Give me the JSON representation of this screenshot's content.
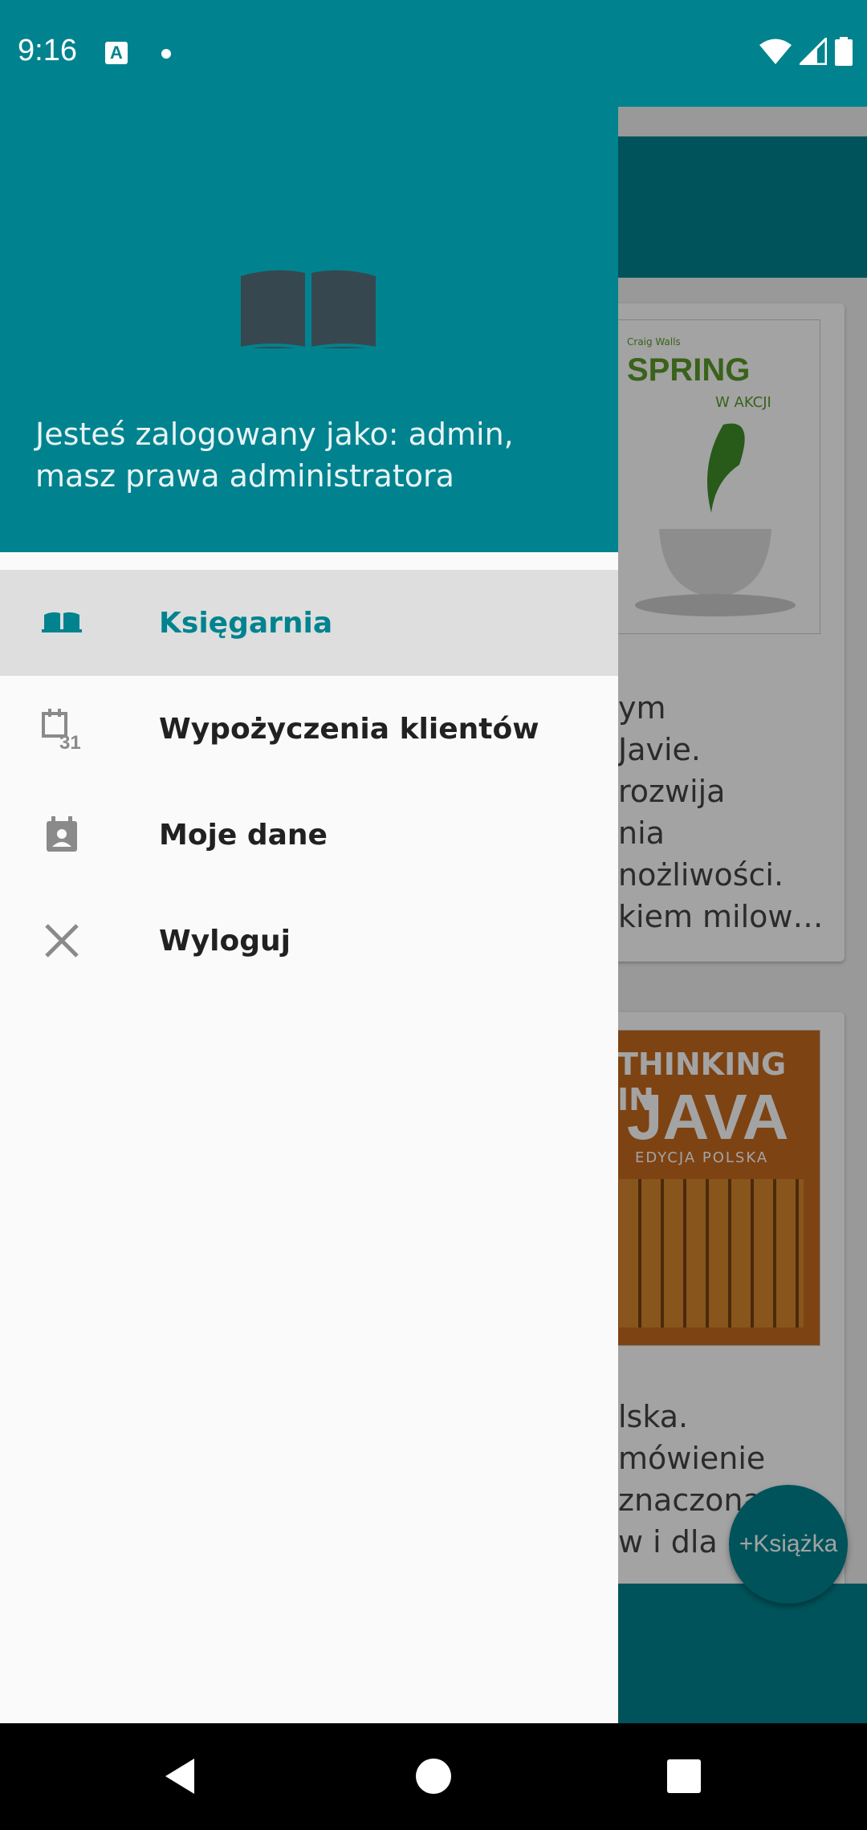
{
  "status_bar": {
    "time": "9:16",
    "notification_letter": "A",
    "icons": [
      "a-notification-icon",
      "dot-icon",
      "wifi-icon",
      "signal-icon",
      "battery-icon"
    ]
  },
  "drawer": {
    "header_text": "Jesteś zalogowany jako: admin, masz prawa administratora",
    "header_icon": "open-book-icon",
    "items": [
      {
        "label": "Księgarnia",
        "icon": "book-icon",
        "active": true
      },
      {
        "label": "Wypożyczenia klientów",
        "icon": "calendar-icon",
        "active": false
      },
      {
        "label": "Moje dane",
        "icon": "contact-icon",
        "active": false
      },
      {
        "label": "Wyloguj",
        "icon": "close-icon",
        "active": false
      }
    ]
  },
  "background": {
    "card1": {
      "cover_author": "Craig Walls",
      "cover_title": "SPRING",
      "cover_subtitle": "W AKCJI",
      "text_lines": [
        "ym",
        "Javie.",
        "rozwija",
        "nia",
        "nożliwości.",
        "kiem milow…"
      ]
    },
    "card2": {
      "cover_title_1": "THINKING IN",
      "cover_title_2": "JAVA",
      "cover_subtitle": "EDYCJA POLSKA",
      "text_lines": [
        "lska.",
        "mówienie",
        "znaczona",
        "w i dla"
      ]
    },
    "fab_label": "+Książka"
  },
  "colors": {
    "primary": "#00838f",
    "active_bg": "#dedede",
    "drawer_bg": "#fafafa"
  },
  "nav_bar": {
    "buttons": [
      "back-icon",
      "home-icon",
      "recents-icon"
    ]
  }
}
